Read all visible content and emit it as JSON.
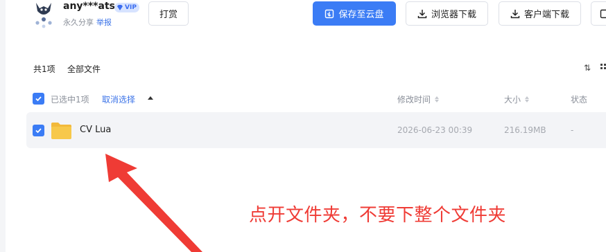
{
  "header": {
    "username": "any***ats",
    "vip_label": "VIP",
    "share_type": "永久分享",
    "report_label": "举报",
    "tip_button": "打赏",
    "save_button": "保存至云盘",
    "browser_download_button": "浏览器下载",
    "client_download_button": "客户端下载"
  },
  "toolbar": {
    "count": "共1项",
    "breadcrumb": "全部文件"
  },
  "table": {
    "selected_text": "已选中1项",
    "cancel_select": "取消选择",
    "columns": {
      "modified": "修改时间",
      "size": "大小",
      "status": "状态"
    },
    "rows": [
      {
        "name": "CV Lua",
        "modified": "2026-06-23 00:39",
        "size": "216.19MB",
        "status": "-"
      }
    ]
  },
  "annotation": {
    "text": "点开文件夹，不要下整个文件夹"
  },
  "colors": {
    "primary": "#3b7cf5",
    "annotation_red": "#ef3b35",
    "folder_yellow": "#f7c84a"
  }
}
